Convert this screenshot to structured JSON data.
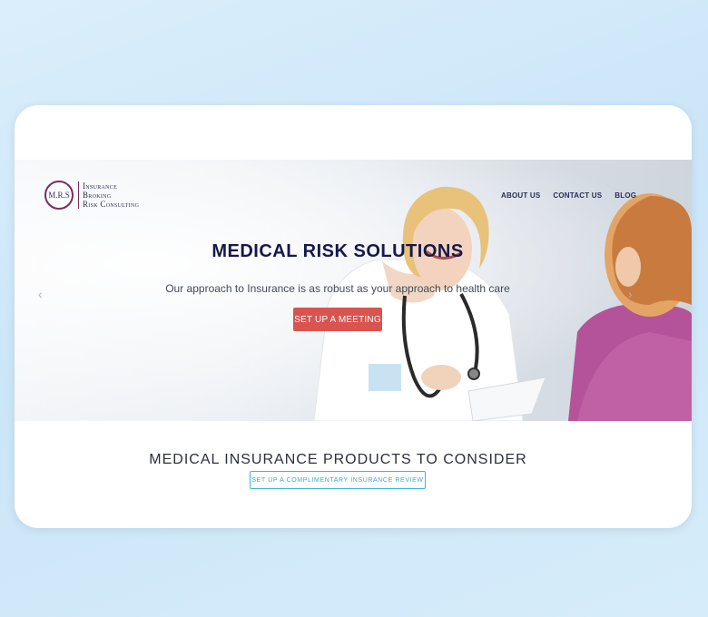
{
  "logo": {
    "monogram": "M.R.S",
    "line1": "Insurance",
    "line2": "Broking",
    "line3": "Risk Consulting"
  },
  "nav": {
    "items": [
      "ABOUT US",
      "CONTACT US",
      "BLOG"
    ]
  },
  "hero": {
    "title": "MEDICAL RISK SOLUTIONS",
    "subtitle": "Our approach to Insurance is as robust as your approach to health care",
    "cta_label": "SET UP A MEETING",
    "prev_arrow": "‹",
    "next_arrow": "›"
  },
  "products": {
    "title": "MEDICAL INSURANCE PRODUCTS TO CONSIDER",
    "button_label": "SET UP A COMPLIMENTARY INSURANCE REVIEW"
  },
  "colors": {
    "accent_red": "#d9534f",
    "accent_blue": "#39b6e0",
    "navy": "#16184a"
  },
  "icons": {
    "prev": "chevron-left-icon",
    "next": "chevron-right-icon"
  }
}
